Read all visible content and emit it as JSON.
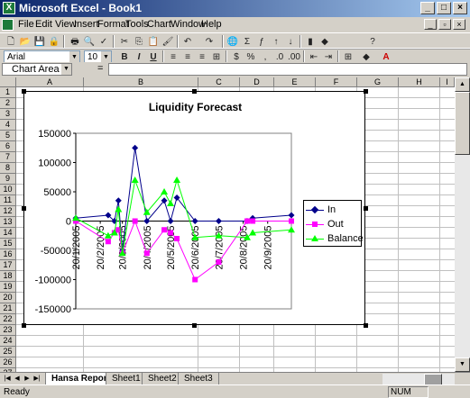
{
  "window": {
    "title": "Microsoft Excel - Book1",
    "app_icon_letter": "X"
  },
  "menu": [
    "File",
    "Edit",
    "View",
    "Insert",
    "Format",
    "Tools",
    "Chart",
    "Window",
    "Help"
  ],
  "toolbar": {
    "font_name": "Arial",
    "font_size": "10",
    "bold": "B",
    "italic": "I",
    "underline": "U"
  },
  "formula_bar": {
    "name_box": "Chart Area",
    "fx": "=",
    "formula": ""
  },
  "columns": [
    "A",
    "B",
    "C",
    "D",
    "E",
    "F",
    "G",
    "H",
    "I"
  ],
  "rows": [
    "1",
    "2",
    "3",
    "4",
    "5",
    "6",
    "7",
    "8",
    "9",
    "10",
    "11",
    "12",
    "13",
    "14",
    "15",
    "16",
    "17",
    "18",
    "19",
    "20",
    "21",
    "22",
    "23",
    "24",
    "25",
    "26",
    "27"
  ],
  "chart_data": {
    "type": "line",
    "title": "Liquidity Forecast",
    "xlabel": "",
    "ylabel": "",
    "ylim": [
      -150000,
      150000
    ],
    "y_ticks": [
      "150000",
      "100000",
      "50000",
      "0",
      "-50000",
      "-100000",
      "-150000"
    ],
    "x_tick_labels": [
      "20/1/2005",
      "20/2/2005",
      "20/3/2005",
      "20/4/2005",
      "20/5/2005",
      "20/6/2005",
      "20/7/2005",
      "20/8/2005",
      "20/9/2005"
    ],
    "x_start": "20/1/2005",
    "x_end": "20/10/2005",
    "legend_position": "right",
    "grid": false,
    "series": [
      {
        "name": "In",
        "color": "#00008b",
        "marker": "diamond",
        "points": [
          [
            "20/1/2005",
            5000
          ],
          [
            "2/3/2005",
            10000
          ],
          [
            "10/3/2005",
            0
          ],
          [
            "15/3/2005",
            35000
          ],
          [
            "20/3/2005",
            -50000
          ],
          [
            "5/4/2005",
            125000
          ],
          [
            "20/4/2005",
            0
          ],
          [
            "12/5/2005",
            35000
          ],
          [
            "20/5/2005",
            0
          ],
          [
            "28/5/2005",
            40000
          ],
          [
            "20/6/2005",
            0
          ],
          [
            "20/7/2005",
            0
          ],
          [
            "25/8/2005",
            0
          ],
          [
            "1/9/2005",
            5000
          ],
          [
            "20/10/2005",
            10000
          ]
        ]
      },
      {
        "name": "Out",
        "color": "#ff00ff",
        "marker": "square",
        "points": [
          [
            "20/1/2005",
            0
          ],
          [
            "2/3/2005",
            -35000
          ],
          [
            "10/3/2005",
            -20000
          ],
          [
            "15/3/2005",
            -15000
          ],
          [
            "20/3/2005",
            -55000
          ],
          [
            "5/4/2005",
            0
          ],
          [
            "20/4/2005",
            -55000
          ],
          [
            "12/5/2005",
            -15000
          ],
          [
            "20/5/2005",
            -20000
          ],
          [
            "28/5/2005",
            -30000
          ],
          [
            "20/6/2005",
            -100000
          ],
          [
            "20/7/2005",
            -70000
          ],
          [
            "25/8/2005",
            0
          ],
          [
            "1/9/2005",
            0
          ],
          [
            "20/10/2005",
            0
          ]
        ]
      },
      {
        "name": "Balance",
        "color": "#00ff00",
        "marker": "triangle",
        "points": [
          [
            "20/1/2005",
            5000
          ],
          [
            "2/3/2005",
            -25000
          ],
          [
            "10/3/2005",
            -20000
          ],
          [
            "15/3/2005",
            20000
          ],
          [
            "20/3/2005",
            -55000
          ],
          [
            "5/4/2005",
            70000
          ],
          [
            "20/4/2005",
            15000
          ],
          [
            "12/5/2005",
            50000
          ],
          [
            "20/5/2005",
            30000
          ],
          [
            "28/5/2005",
            70000
          ],
          [
            "20/6/2005",
            -28000
          ],
          [
            "20/7/2005",
            -25000
          ],
          [
            "25/8/2005",
            -28000
          ],
          [
            "1/9/2005",
            -20000
          ],
          [
            "20/10/2005",
            -15000
          ]
        ]
      }
    ]
  },
  "sheets": [
    "Hansa Report",
    "Sheet1",
    "Sheet2",
    "Sheet3"
  ],
  "status": {
    "left": "Ready",
    "num": "NUM"
  }
}
